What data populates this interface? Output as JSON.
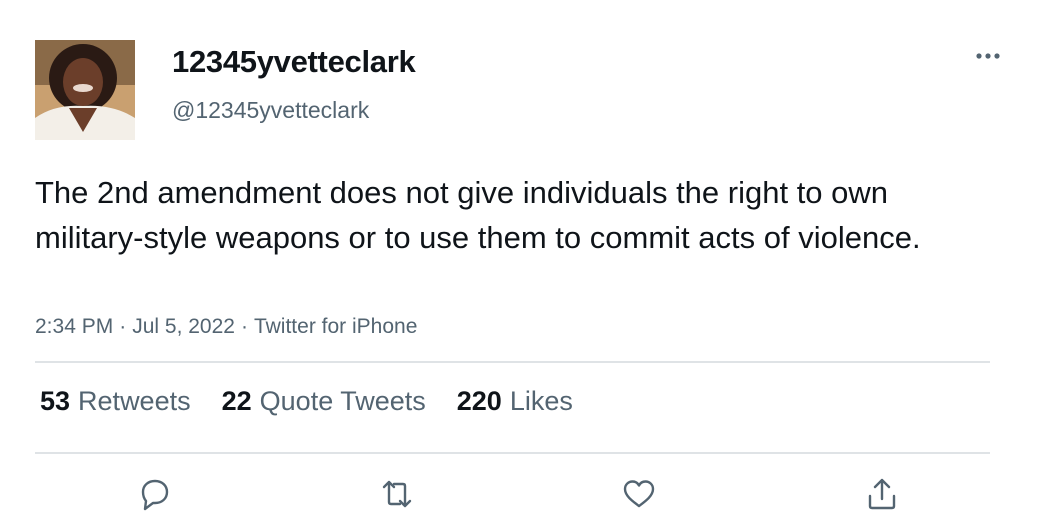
{
  "user": {
    "display_name": "12345yvetteclark",
    "handle": "@12345yvetteclark",
    "avatar_icon": "profile-photo"
  },
  "tweet": {
    "text": "The 2nd amendment does not give individuals the right to own military-style weapons or to use them to commit acts of violence.",
    "time": "2:34 PM",
    "date": "Jul 5, 2022",
    "source": "Twitter for iPhone",
    "separator": "·"
  },
  "stats": {
    "retweets": {
      "count": "53",
      "label": "Retweets"
    },
    "quote_tweets": {
      "count": "22",
      "label": "Quote Tweets"
    },
    "likes": {
      "count": "220",
      "label": "Likes"
    }
  },
  "actions": [
    "reply-icon",
    "retweet-icon",
    "like-icon",
    "share-icon"
  ],
  "colors": {
    "text": "#0f1419",
    "secondary": "#536471",
    "divider": "#dfe3e6"
  }
}
